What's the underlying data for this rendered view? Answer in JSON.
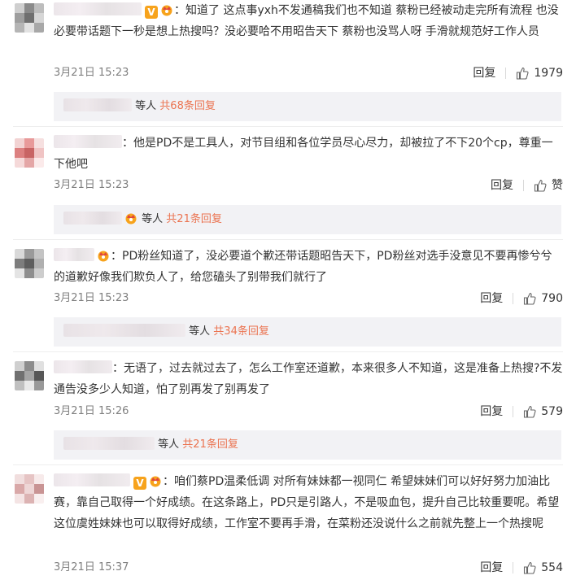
{
  "comments": [
    {
      "text": "：知道了 这点事yxh不发通稿我们也不知道 蔡粉已经被动走完所有流程 也没必要带话题下一秒是想上热搜吗？没必要哈不用昭告天下 蔡粉也没骂人呀 手滑就规范好工作人员",
      "time": "3月21日 15:23",
      "reply_label": "回复",
      "likes": "1979",
      "replies_prefix": "等人",
      "replies_total": "共68条回复"
    },
    {
      "text": "：他是PD不是工具人，对节目组和各位学员尽心尽力，却被拉了不下20个cp，尊重一下他吧",
      "time": "3月21日 15:23",
      "reply_label": "回复",
      "likes": "赞",
      "replies_prefix": "等人",
      "replies_total": "共21条回复"
    },
    {
      "text": "：PD粉丝知道了，没必要道个歉还带话题昭告天下，PD粉丝对选手没意见不要再惨兮兮的道歉好像我们欺负人了，给您磕头了别带我们就行了",
      "time": "3月21日 15:23",
      "reply_label": "回复",
      "likes": "790",
      "replies_prefix": "等人",
      "replies_total": "共34条回复"
    },
    {
      "text": "：无语了，过去就过去了，怎么工作室还道歉，本来很多人不知道，这是准备上热搜?不发通告没多少人知道，怕了别再发了别再发了",
      "time": "3月21日 15:26",
      "reply_label": "回复",
      "likes": "579",
      "replies_prefix": "等人",
      "replies_total": "共21条回复"
    },
    {
      "text": "：咱们蔡PD温柔低调 对所有妹妹都一视同仁 希望妹妹们可以好好努力加油比赛，靠自己取得一个好成绩。在这条路上，PD只是引路人，不是吸血包，提升自己比较重要呢。希望这位虞姓妹妹也可以取得好成绩，工作室不要再手滑，在菜粉还没说什么之前就先整上一个热搜呢",
      "time": "3月21日 15:37",
      "reply_label": "回复",
      "likes": "554"
    }
  ],
  "badge_v_text": "V",
  "colors": {
    "accent": "#eb7350",
    "vip": "#f7a31c",
    "reply_bg": "#f2f2f5"
  }
}
